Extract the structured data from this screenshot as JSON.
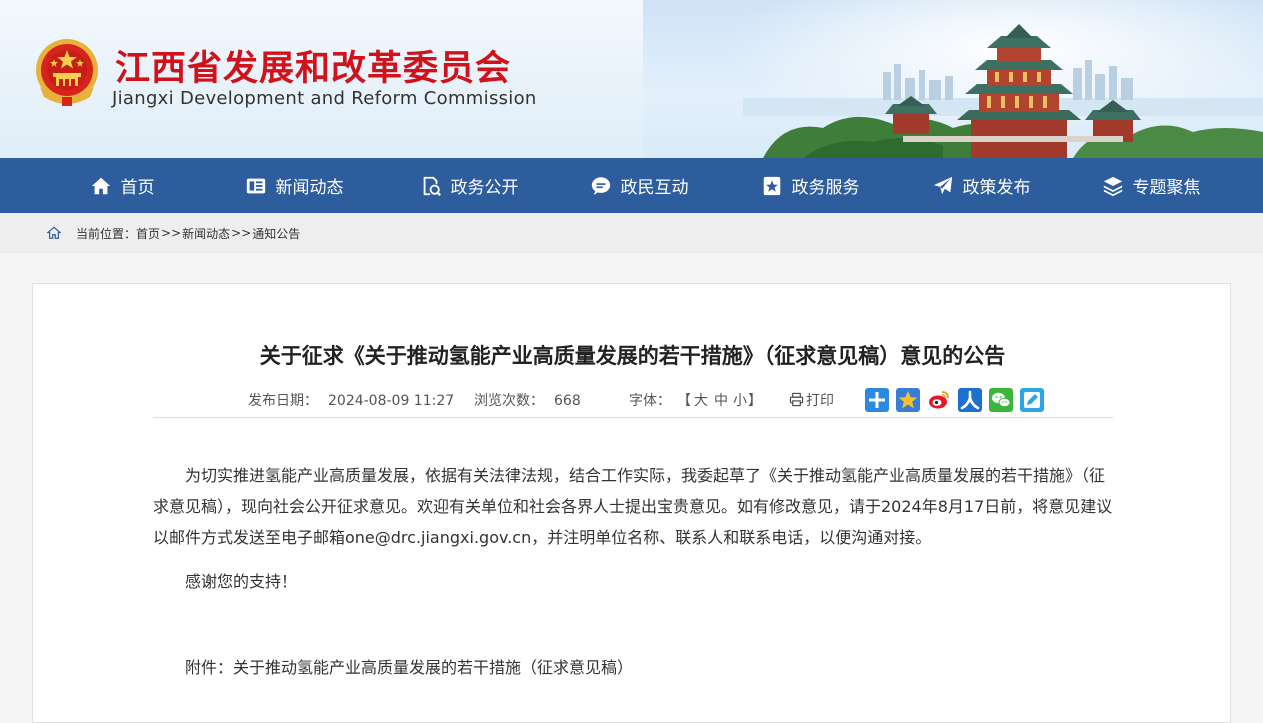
{
  "header": {
    "title_cn": "江西省发展和改革委员会",
    "title_en": "Jiangxi Development and Reform Commission"
  },
  "nav": {
    "items": [
      {
        "label": "首页",
        "icon": "home-icon"
      },
      {
        "label": "新闻动态",
        "icon": "newspaper-icon"
      },
      {
        "label": "政务公开",
        "icon": "search-document-icon"
      },
      {
        "label": "政民互动",
        "icon": "chat-bubble-icon"
      },
      {
        "label": "政务服务",
        "icon": "star-badge-icon"
      },
      {
        "label": "政策发布",
        "icon": "paper-plane-icon"
      },
      {
        "label": "专题聚焦",
        "icon": "layers-icon"
      }
    ]
  },
  "breadcrumb": {
    "prefix": "当前位置：",
    "items": [
      "首页",
      "新闻动态",
      "通知公告"
    ],
    "separator": ">>"
  },
  "article": {
    "title": "关于征求《关于推动氢能产业高质量发展的若干措施》（征求意见稿）意见的公告",
    "publish_label": "发布日期：",
    "publish_date": "2024-08-09 11:27",
    "views_label": "浏览次数：",
    "views": "668",
    "font_label": "字体：",
    "font_open": "【",
    "font_large": "大",
    "font_medium": "中",
    "font_small": "小",
    "font_close": "】",
    "print_label": "打印",
    "share_icons": [
      "plus-share-icon",
      "qzone-star-icon",
      "weibo-icon",
      "renren-icon",
      "wechat-icon",
      "edit-note-icon"
    ],
    "paragraph1": "为切实推进氢能产业高质量发展，依据有关法律法规，结合工作实际，我委起草了《关于推动氢能产业高质量发展的若干措施》（征求意见稿），现向社会公开征求意见。欢迎有关单位和社会各界人士提出宝贵意见。如有修改意见，请于2024年8月17日前，将意见建议以邮件方式发送至电子邮箱one@drc.jiangxi.gov.cn，并注明单位名称、联系人和联系电话，以便沟通对接。",
    "paragraph2": "感谢您的支持！",
    "attachment_label": "附件：",
    "attachment_name": "关于推动氢能产业高质量发展的若干措施（征求意见稿）"
  },
  "colors": {
    "title_red": "#d0121b",
    "nav_blue": "#2e5d9e"
  }
}
